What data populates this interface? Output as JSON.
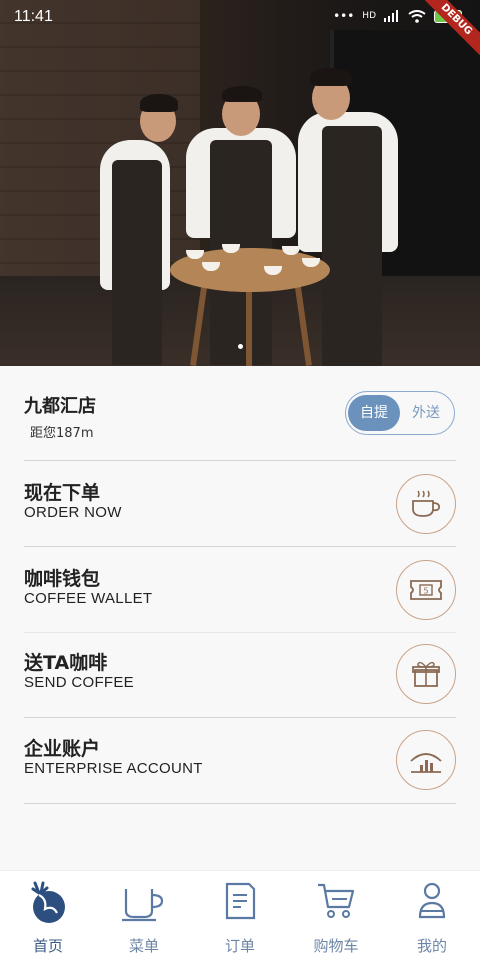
{
  "status_bar": {
    "time": "11:41",
    "signal": "•••",
    "network": "HD",
    "battery": "96",
    "debug_banner": "DEBUG"
  },
  "store": {
    "name": "九都汇店",
    "distance": "距您187m"
  },
  "mode_toggle": {
    "pickup": "自提",
    "delivery": "外送",
    "selected": "自提"
  },
  "menu": [
    {
      "zh": "现在下单",
      "en": "ORDER NOW",
      "icon": "coffee-cup-icon"
    },
    {
      "zh": "咖啡钱包",
      "en": "COFFEE WALLET",
      "icon": "ticket-icon"
    },
    {
      "zh": "送TA咖啡",
      "en": "SEND COFFEE",
      "icon": "gift-icon"
    },
    {
      "zh": "企业账户",
      "en": "ENTERPRISE ACCOUNT",
      "icon": "enterprise-chart-icon"
    }
  ],
  "tabs": [
    {
      "label": "首页",
      "icon": "deer-logo-icon",
      "active": true
    },
    {
      "label": "菜单",
      "icon": "cup-icon"
    },
    {
      "label": "订单",
      "icon": "order-list-icon"
    },
    {
      "label": "购物车",
      "icon": "cart-icon"
    },
    {
      "label": "我的",
      "icon": "user-icon"
    }
  ],
  "colors": {
    "accent": "#6b92bd",
    "icon_border": "#c9a389",
    "tab_active": "#3b5b85",
    "tab_inactive": "#6d86a6"
  }
}
